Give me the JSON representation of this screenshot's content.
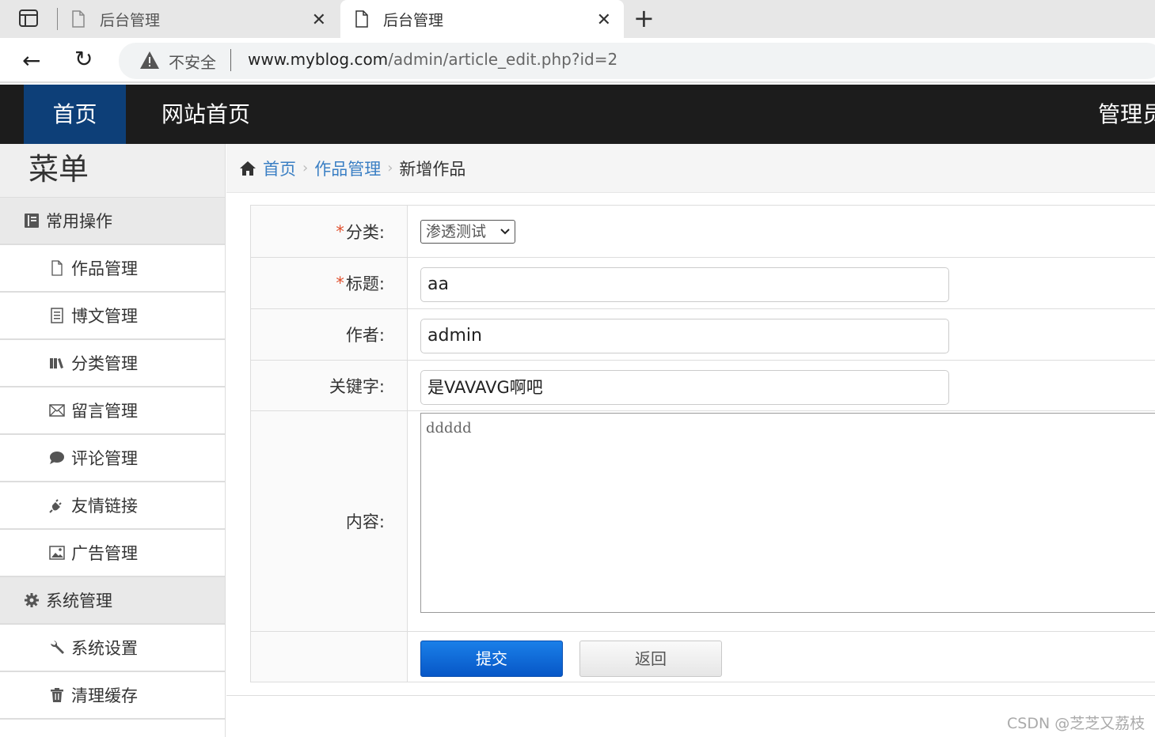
{
  "browser": {
    "tabs": [
      {
        "title": "后台管理"
      },
      {
        "title": "后台管理"
      }
    ],
    "security_label": "不安全",
    "url_host": "www.myblog.com",
    "url_path": "/admin/article_edit.php?id=2"
  },
  "topnav": {
    "home": "首页",
    "site_home": "网站首页",
    "admin": "管理员"
  },
  "sidebar": {
    "title": "菜单",
    "groups": [
      {
        "label": "常用操作",
        "items": [
          "作品管理",
          "博文管理",
          "分类管理",
          "留言管理",
          "评论管理",
          "友情链接",
          "广告管理"
        ]
      },
      {
        "label": "系统管理",
        "items": [
          "系统设置",
          "清理缓存"
        ]
      }
    ]
  },
  "breadcrumb": {
    "home": "首页",
    "section": "作品管理",
    "current": "新增作品"
  },
  "form": {
    "category_label": "分类:",
    "category_value": "渗透测试",
    "title_label": "标题:",
    "title_value": "aa",
    "author_label": "作者:",
    "author_value": "admin",
    "keywords_label": "关键字:",
    "keywords_value": "是VAVAVG啊吧",
    "content_label": "内容:",
    "content_value": "ddddd",
    "submit_label": "提交",
    "back_label": "返回",
    "required_mark": "*"
  },
  "watermark": "CSDN @芝芝又荔枝"
}
